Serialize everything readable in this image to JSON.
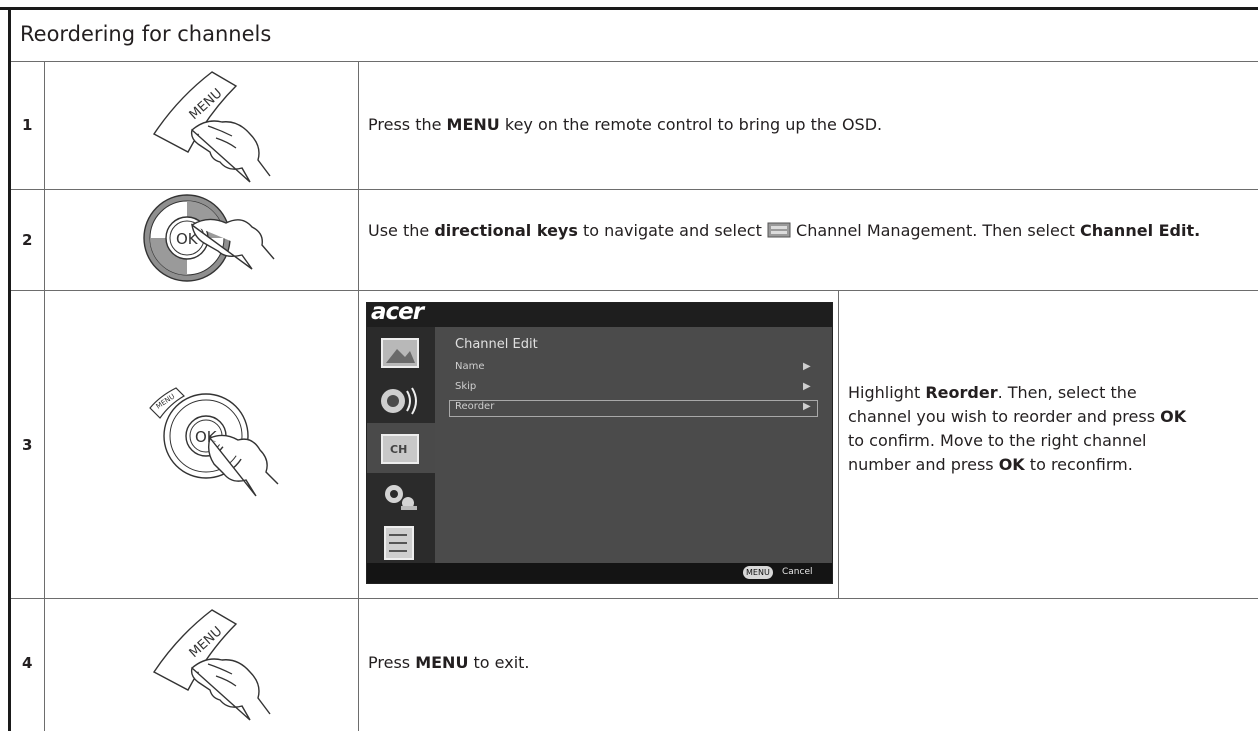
{
  "header": {
    "title": "Reordering for channels"
  },
  "steps": [
    {
      "number": "1",
      "button_label": "MENU",
      "text": {
        "a": "Press the ",
        "b1": "MENU",
        "c": " key on the remote control to bring up the OSD."
      }
    },
    {
      "number": "2",
      "button_label": "OK",
      "text": {
        "a": "Use the ",
        "b1": "directional keys",
        "c": " to navigate and select ",
        "d": " Channel Management. Then select ",
        "b2": "Channel Edit."
      }
    },
    {
      "number": "3",
      "button_label_menu": "MENU",
      "button_label_ok": "OK",
      "osd": {
        "logo": "acer",
        "title": "Channel Edit",
        "items": [
          "Name",
          "Skip",
          "Reorder"
        ],
        "footer_key": "MENU",
        "footer_action": "Cancel",
        "icon_label": "CH"
      },
      "text": {
        "a": "Highlight ",
        "b1": "Reorder",
        "c": ". Then, select the channel you wish to reorder and press ",
        "b2": "OK",
        "d": " to confirm. Move to the right channel number and press ",
        "b3": "OK",
        "e": " to reconfirm."
      }
    },
    {
      "number": "4",
      "button_label": "MENU",
      "text": {
        "a": "Press ",
        "b1": "MENU",
        "c": " to exit."
      }
    }
  ]
}
